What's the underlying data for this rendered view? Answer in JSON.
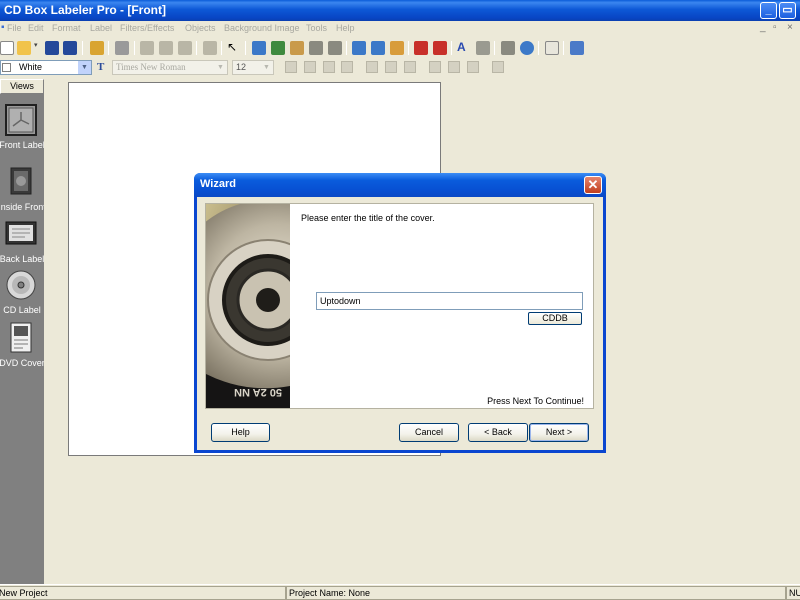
{
  "window": {
    "title": "CD Box Labeler Pro - [Front]"
  },
  "menu": [
    "File",
    "Edit",
    "Format",
    "Label",
    "Filters/Effects",
    "Objects",
    "Background Image",
    "Tools",
    "Help"
  ],
  "format_bar": {
    "color_value": "White",
    "font_name": "Times New Roman",
    "font_size": "12"
  },
  "views": {
    "header": "Views",
    "items": [
      {
        "label": "Front Label",
        "icon": "front-label-icon",
        "selected": true
      },
      {
        "label": "Inside Front",
        "icon": "inside-front-icon",
        "selected": false
      },
      {
        "label": "Back Label",
        "icon": "back-label-icon",
        "selected": false
      },
      {
        "label": "CD Label",
        "icon": "cd-label-icon",
        "selected": false
      },
      {
        "label": "DVD Cover",
        "icon": "dvd-cover-icon",
        "selected": false
      }
    ]
  },
  "wizard": {
    "title": "Wizard",
    "prompt": "Please enter the title of the cover.",
    "title_value": "Uptodown",
    "cddb_label": "CDDB",
    "hint": "Press Next To Continue!",
    "buttons": {
      "help": "Help",
      "cancel": "Cancel",
      "back": "< Back",
      "next": "Next >"
    }
  },
  "status": {
    "left": "New Project",
    "middle": "Project Name: None",
    "right": "NUM"
  },
  "colors": {
    "titlebar": "#0a5cd8",
    "sidebar": "#808080",
    "chrome": "#ece9d8"
  }
}
